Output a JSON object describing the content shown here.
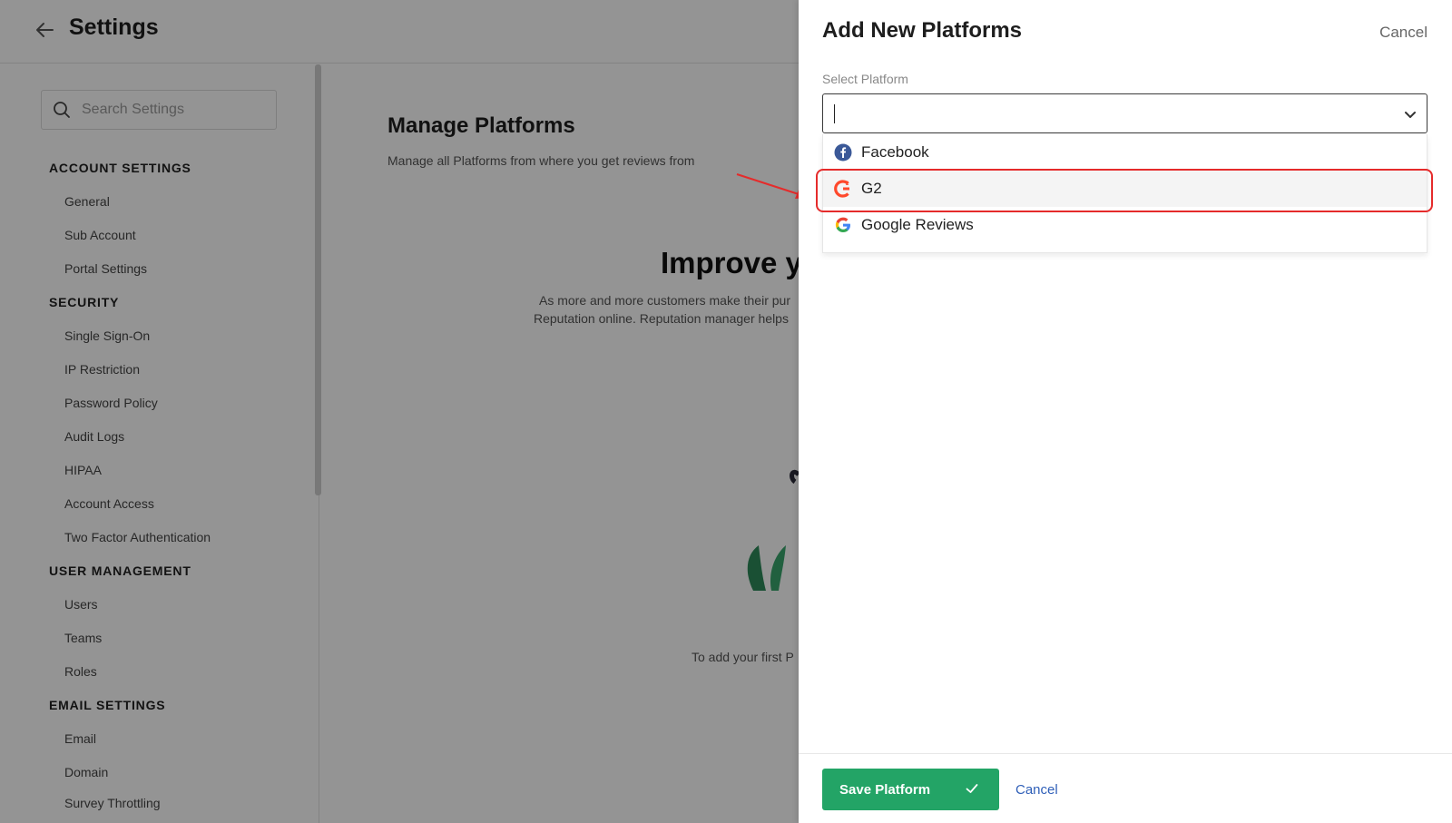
{
  "header": {
    "title": "Settings"
  },
  "sidebar": {
    "search_placeholder": "Search Settings",
    "sections": [
      {
        "title": "ACCOUNT SETTINGS",
        "items": [
          "General",
          "Sub Account",
          "Portal Settings"
        ]
      },
      {
        "title": "SECURITY",
        "items": [
          "Single Sign-On",
          "IP Restriction",
          "Password Policy",
          "Audit Logs",
          "HIPAA",
          "Account Access",
          "Two Factor Authentication"
        ]
      },
      {
        "title": "USER MANAGEMENT",
        "items": [
          "Users",
          "Teams",
          "Roles"
        ]
      },
      {
        "title": "EMAIL SETTINGS",
        "items": [
          "Email",
          "Domain",
          "Survey Throttling"
        ]
      }
    ]
  },
  "main": {
    "title": "Manage Platforms",
    "subtitle": "Manage all Platforms from where you get reviews from",
    "hero_title": "Improve y",
    "hero_line1": "As more and more customers make their pur",
    "hero_line2": "Reputation online. Reputation manager helps",
    "hero_footer": "To add your first P"
  },
  "drawer": {
    "title": "Add New Platforms",
    "cancel_top": "Cancel",
    "field_label": "Select Platform",
    "select_value": "",
    "options": [
      {
        "label": "Facebook",
        "icon": "facebook-icon"
      },
      {
        "label": "G2",
        "icon": "g2-icon"
      },
      {
        "label": "Google Reviews",
        "icon": "google-icon"
      }
    ],
    "selected_option": "G2",
    "save_label": "Save Platform",
    "cancel_bottom": "Cancel"
  },
  "colors": {
    "accent_green": "#23a466",
    "link_blue": "#2f5fb8",
    "annotation_red": "#e52b2b",
    "facebook_blue": "#3b5998",
    "g2_red": "#ff492c"
  }
}
